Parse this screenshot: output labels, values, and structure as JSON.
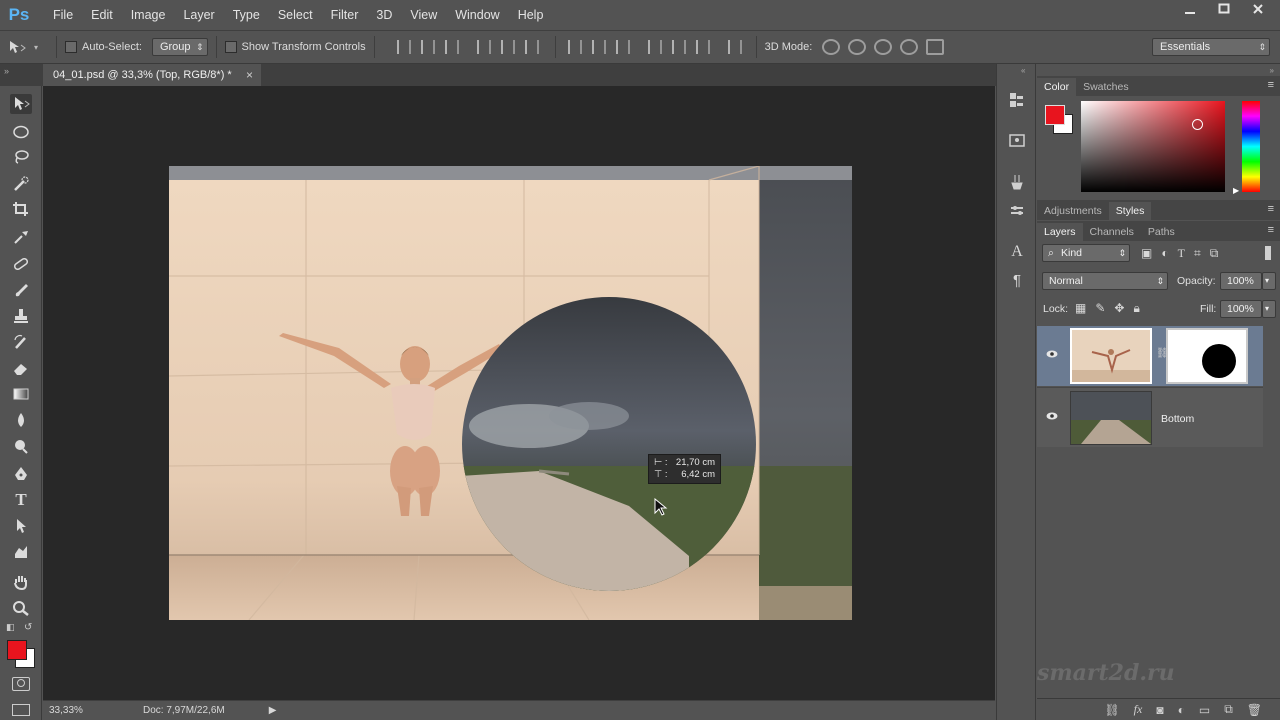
{
  "app": {
    "logo": "Ps"
  },
  "menu": [
    "File",
    "Edit",
    "Image",
    "Layer",
    "Type",
    "Select",
    "Filter",
    "3D",
    "View",
    "Window",
    "Help"
  ],
  "options": {
    "auto_select_label": "Auto-Select:",
    "auto_select_value": "Group",
    "transform_label": "Show Transform Controls",
    "mode_3d_label": "3D Mode:",
    "workspace_value": "Essentials"
  },
  "document": {
    "tab_title": "04_01.psd @ 33,3% (Top, RGB/8*) *",
    "tab_close": "×",
    "zoom": "33,33%",
    "doc_info": "Doc: 7,97M/22,6M"
  },
  "measure_tooltip": {
    "dx": "21,70 cm",
    "dy": "6,42 cm"
  },
  "colors": {
    "foreground": "#e8141e",
    "background": "#ffffff",
    "accent": "#e8141e"
  },
  "panels": {
    "color_tabs": [
      "Color",
      "Swatches"
    ],
    "adjust_tabs": [
      "Adjustments",
      "Styles"
    ],
    "layers_tabs": [
      "Layers",
      "Channels",
      "Paths"
    ],
    "kind_label": "Kind",
    "blend_mode": "Normal",
    "opacity_label": "Opacity:",
    "opacity_value": "100%",
    "lock_label": "Lock:",
    "fill_label": "Fill:",
    "fill_value": "100%",
    "layers": [
      {
        "name": "",
        "has_mask": true
      },
      {
        "name": "Bottom",
        "has_mask": false
      }
    ]
  },
  "watermark": "smart2d.ru",
  "icons": [
    "move-icon",
    "ellipse-marquee-icon",
    "lasso-icon",
    "quick-select-icon",
    "crop-icon",
    "eyedropper-icon",
    "healing-icon",
    "brush-icon",
    "stamp-icon",
    "history-brush-icon",
    "eraser-icon",
    "gradient-icon",
    "blur-icon",
    "dodge-icon",
    "pen-icon",
    "type-icon",
    "path-select-icon",
    "shape-icon",
    "hand-icon",
    "zoom-icon"
  ]
}
